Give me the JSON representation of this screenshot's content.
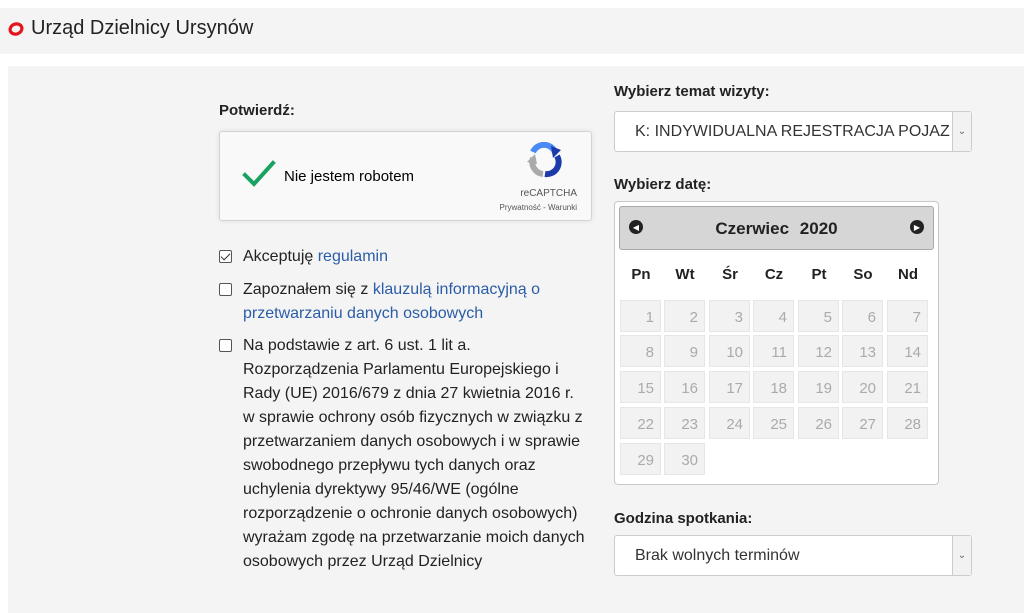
{
  "header": {
    "title": "Urząd Dzielnicy Ursynów",
    "icon": "ursynow-logo-icon",
    "accent": "#e3141c"
  },
  "confirm": {
    "title": "Potwierdź:",
    "recaptcha": {
      "label": "Nie jestem robotem",
      "brand": "reCAPTCHA",
      "links": "Prywatność - Warunki",
      "checked": true
    }
  },
  "consents": [
    {
      "checked": true,
      "text": "Akceptuję ",
      "link": "regulamin",
      "text_after": ""
    },
    {
      "checked": false,
      "text": "Zapoznałem się z ",
      "link": "klauzulą informacyjną o przetwarzaniu danych osobowych",
      "text_after": ""
    },
    {
      "checked": false,
      "text": "Na podstawie z art. 6 ust. 1 lit a. Rozporządzenia Parlamentu Europejskiego i Rady (UE) 2016/679 z dnia 27 kwietnia 2016 r. w sprawie ochrony osób fizycznych w związku z przetwarzaniem danych osobowych i w sprawie swobodnego przepływu tych danych oraz uchylenia dyrektywy 95/46/WE (ogólne rozporządzenie o ochronie danych osobowych) wyrażam zgodę na przetwarzanie moich danych osobowych przez Urząd Dzielnicy",
      "link": "",
      "text_after": ""
    }
  ],
  "visit": {
    "title": "Wybierz temat wizyty:",
    "selected": "K: INDYWIDUALNA REJESTRACJA POJAZDU"
  },
  "date": {
    "title": "Wybierz datę:",
    "month": "Czerwiec",
    "year": "2020",
    "weekdays": [
      "Pn",
      "Wt",
      "Śr",
      "Cz",
      "Pt",
      "So",
      "Nd"
    ],
    "days": [
      "1",
      "2",
      "3",
      "4",
      "5",
      "6",
      "7",
      "8",
      "9",
      "10",
      "11",
      "12",
      "13",
      "14",
      "15",
      "16",
      "17",
      "18",
      "19",
      "20",
      "21",
      "22",
      "23",
      "24",
      "25",
      "26",
      "27",
      "28",
      "29",
      "30"
    ],
    "prev_icon": "chevron-left-icon",
    "next_icon": "chevron-right-icon"
  },
  "time": {
    "title": "Godzina spotkania:",
    "selected": "Brak wolnych terminów"
  }
}
